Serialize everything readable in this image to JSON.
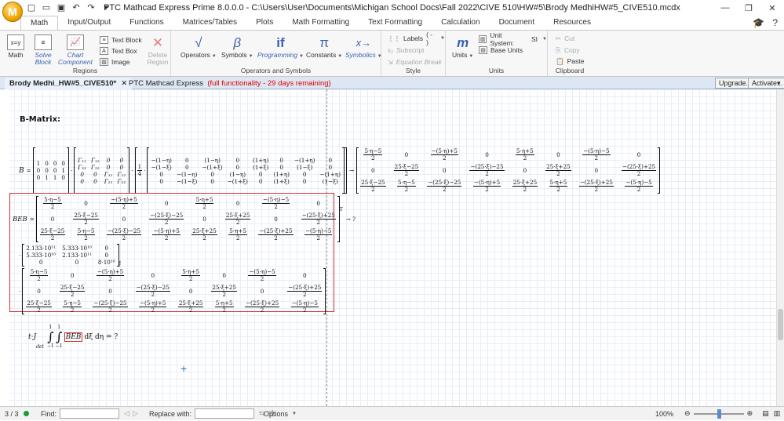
{
  "titlebar": {
    "title": "PTC Mathcad Express Prime 8.0.0.0 - C:\\Users\\User\\Documents\\Michigan School Docs\\Fall 2022\\CIVE 510\\HW#5\\Brody MedhiHW#5_CIVE510.mcdx",
    "app_logo": "M"
  },
  "tabs": [
    "Math",
    "Input/Output",
    "Functions",
    "Matrices/Tables",
    "Plots",
    "Math Formatting",
    "Text Formatting",
    "Calculation",
    "Document",
    "Resources"
  ],
  "ribbon": {
    "math": "Math",
    "solve_block": "Solve Block",
    "chart_component": "Chart Component",
    "text_block": "Text Block",
    "text_box": "Text Box",
    "image": "Image",
    "delete_region": "Delete Region",
    "regions_label": "Regions",
    "operators": "Operators",
    "symbols": "Symbols",
    "programming": "Programming",
    "constants": "Constants",
    "symbolics": "Symbolics",
    "ops_label": "Operators and Symbols",
    "labels": "Labels",
    "labels_value": "( - )",
    "subscript": "Subscript",
    "equation_break": "Equation Break",
    "style_label": "Style",
    "units": "Units",
    "unit_system": "Unit System:",
    "unit_system_value": "SI",
    "base_units": "Base Units",
    "units_label": "Units",
    "cut": "Cut",
    "copy": "Copy",
    "paste": "Paste",
    "clipboard_label": "Clipboard"
  },
  "doc": {
    "tab_name": "Brody Medhi_HW#5_CIVE510*",
    "product": "PTC Mathcad Express",
    "trial_note": "(full functionality - 29 days remaining)",
    "upgrade": "Upgrade...",
    "activate": "Activate..."
  },
  "worksheet": {
    "heading": "B-Matrix:",
    "b_label": "B",
    "beb_label": "BEB",
    "arrow": "→",
    "integral_expr": "t·J",
    "integral_sub": "det",
    "integral_tail": "dξ dη = ?",
    "integral_var": "BEB",
    "lim_upper": "1",
    "lim_lower": "−1",
    "quarter": "1 / 4",
    "b_left": [
      [
        "1",
        "0",
        "0",
        "0"
      ],
      [
        "0",
        "0",
        "0",
        "1"
      ],
      [
        "0",
        "1",
        "1",
        "0"
      ]
    ],
    "gamma": [
      [
        "Γ₁₁",
        "Γ₁₂",
        "0",
        "0"
      ],
      [
        "Γ₂₁",
        "Γ₂₂",
        "0",
        "0"
      ],
      [
        "0",
        "0",
        "Γ₁₁",
        "Γ₁₂"
      ],
      [
        "0",
        "0",
        "Γ₂₁",
        "Γ₂₂"
      ]
    ],
    "n_matrix": [
      [
        "−(1−η)",
        "0",
        "(1−η)",
        "0",
        "(1+η)",
        "0",
        "−(1+η)",
        "0"
      ],
      [
        "−(1−ξ)",
        "0",
        "−(1+ξ)",
        "0",
        "(1+ξ)",
        "0",
        "(1−ξ)",
        "0"
      ],
      [
        "0",
        "−(1−η)",
        "0",
        "(1−η)",
        "0",
        "(1+η)",
        "0",
        "−(1+η)"
      ],
      [
        "0",
        "−(1−ξ)",
        "0",
        "−(1+ξ)",
        "0",
        "(1+ξ)",
        "0",
        "(1−ξ)"
      ]
    ],
    "b_result": [
      [
        "5·η−5|2",
        "0",
        "−(5·η)+5|2",
        "0",
        "5·η+5|2",
        "0",
        "−(5·η)−5|2",
        "0"
      ],
      [
        "0",
        "25·ξ−25|2",
        "0",
        "−(25·ξ)−25|2",
        "0",
        "25·ξ+25|2",
        "0",
        "−(25·ξ)+25|2"
      ],
      [
        "25·ξ−25|2",
        "5·η−5|2",
        "−(25·ξ)−25|2",
        "−(5·η)+5|2",
        "25·ξ+25|2",
        "5·η+5|2",
        "−(25·ξ)+25|2",
        "−(5·η)−5|2"
      ]
    ],
    "e_matrix": [
      [
        "2.133·10¹¹",
        "5.333·10¹⁰",
        "0"
      ],
      [
        "5.333·10¹⁰",
        "2.133·10¹¹",
        "0"
      ],
      [
        "0",
        "0",
        "8·10¹⁰"
      ]
    ],
    "beb_arrow": "→ ?"
  },
  "statusbar": {
    "page": "3 / 3",
    "find": "Find:",
    "replace": "Replace with:",
    "options": "Options",
    "zoom": "100%"
  }
}
